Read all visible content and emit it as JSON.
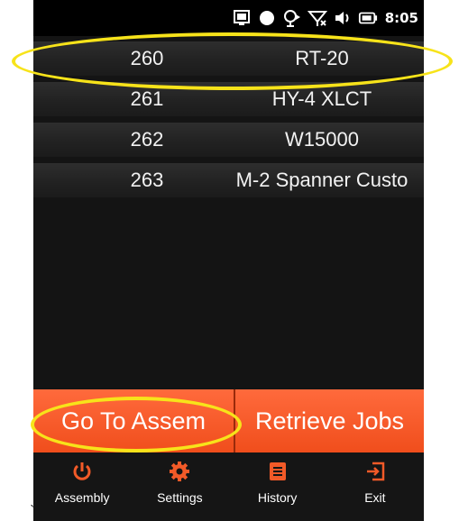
{
  "status_bar": {
    "icons": [
      "window-icon",
      "record-icon",
      "sync-icon",
      "no-signal-icon",
      "volume-icon",
      "battery-icon"
    ],
    "time": "8:05"
  },
  "job_list": [
    {
      "number": "260",
      "name": "RT-20"
    },
    {
      "number": "261",
      "name": "HY-4 XLCT"
    },
    {
      "number": "262",
      "name": "W15000"
    },
    {
      "number": "263",
      "name": "M-2 Spanner Custo"
    }
  ],
  "actions": {
    "go_to_assembly": "Go To Assem",
    "retrieve_jobs": "Retrieve Jobs"
  },
  "nav": {
    "assembly": "Assembly",
    "settings": "Settings",
    "history": "History",
    "exit": "Exit"
  },
  "colors": {
    "accent": "#f25a28",
    "highlight": "#f7e31a",
    "background": "#141414"
  },
  "stray_mark": "`"
}
